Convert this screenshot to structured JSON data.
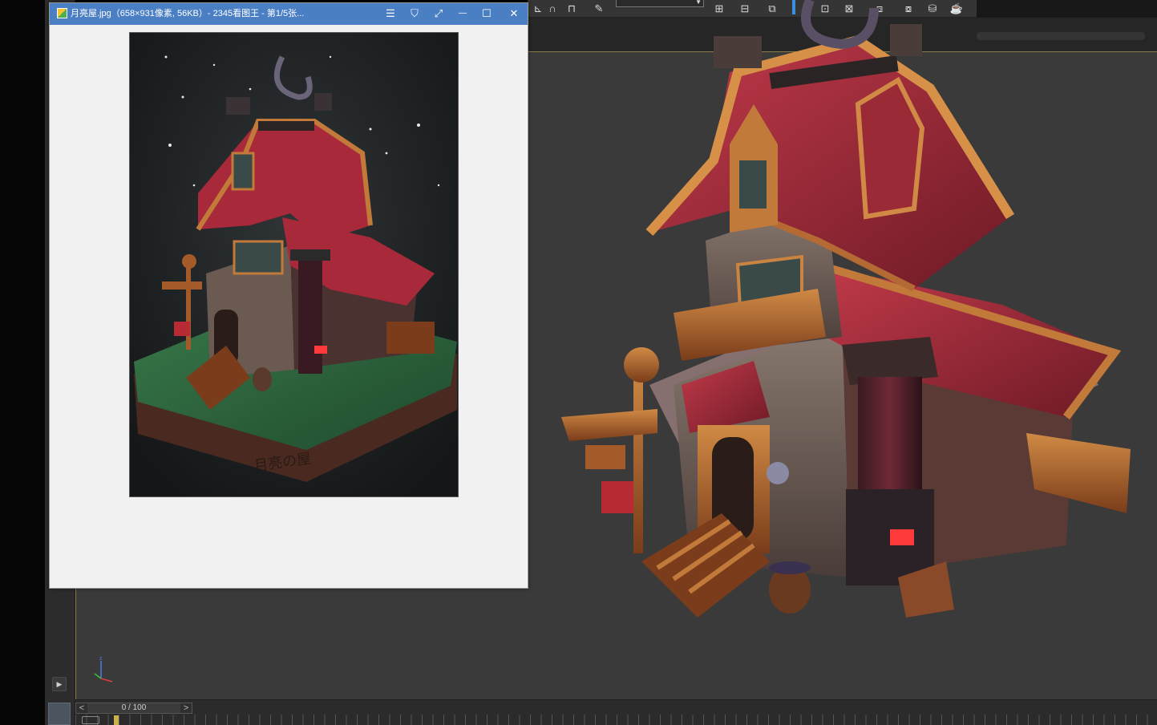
{
  "viewer": {
    "title": "月亮屋.jpg（658×931像素, 56KB）- 2345看图王 - 第1/5张...",
    "buttons": {
      "menu": "☰",
      "skin": "⛉",
      "fullscreen": "⤢",
      "minimize": "—",
      "maximize": "☐",
      "close": "✕"
    }
  },
  "timeline": {
    "frame_label": "0 / 100",
    "prev": "<",
    "next": ">"
  },
  "sidebar": {
    "play_glyph": "▶"
  },
  "colors": {
    "titlebar": "#4a7fc4",
    "viewport": "#3a3a3a",
    "roof": "#a8293a",
    "wood": "#a55a2a"
  },
  "icons": [
    "menu-icon",
    "skin-icon",
    "fullscreen-icon",
    "minimize-icon",
    "maximize-icon",
    "close-icon",
    "play-icon",
    "axis-gizmo-icon"
  ]
}
